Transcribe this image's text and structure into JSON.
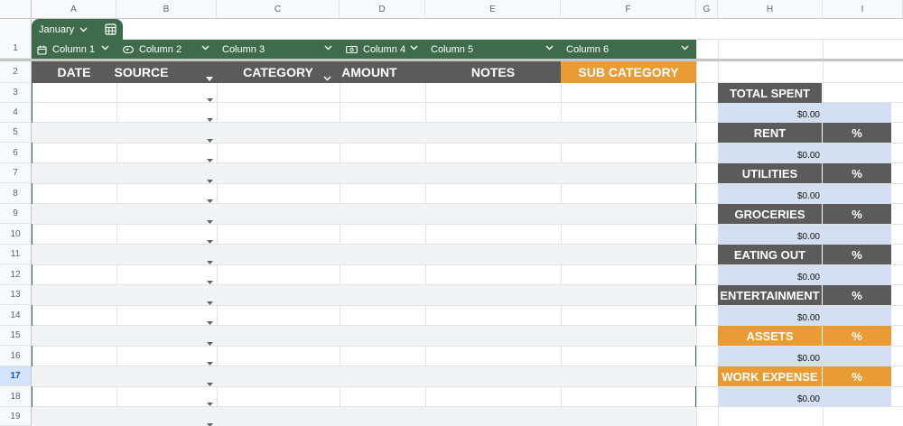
{
  "columns": [
    "A",
    "B",
    "C",
    "D",
    "E",
    "F",
    "G",
    "H",
    "I"
  ],
  "rows": [
    "1",
    "2",
    "3",
    "4",
    "5",
    "6",
    "7",
    "8",
    "9",
    "10",
    "11",
    "12",
    "13",
    "14",
    "15",
    "16",
    "17",
    "18",
    "19"
  ],
  "active_row": "17",
  "table": {
    "name": "January",
    "chips": [
      {
        "label": "Column 1",
        "icon": "calendar-icon"
      },
      {
        "label": "Column 2",
        "icon": "dropdown-chip-icon"
      },
      {
        "label": "Column 3",
        "icon": ""
      },
      {
        "label": "Column 4",
        "icon": "currency-icon"
      },
      {
        "label": "Column 5",
        "icon": ""
      },
      {
        "label": "Column 6",
        "icon": ""
      }
    ],
    "headers": [
      "DATE",
      "SOURCE",
      "CATEGORY",
      "AMOUNT",
      "NOTES",
      "SUB CATEGORY"
    ]
  },
  "summary": [
    {
      "title": "TOTAL SPENT",
      "pct": "",
      "value": "$0.00",
      "color": "#5b5b5b"
    },
    {
      "title": "RENT",
      "pct": "%",
      "value": "$0.00",
      "color": "#5b5b5b"
    },
    {
      "title": "UTILITIES",
      "pct": "%",
      "value": "$0.00",
      "color": "#5b5b5b"
    },
    {
      "title": "GROCERIES",
      "pct": "%",
      "value": "$0.00",
      "color": "#5b5b5b"
    },
    {
      "title": "EATING OUT",
      "pct": "%",
      "value": "$0.00",
      "color": "#5b5b5b"
    },
    {
      "title": "ENTERTAINMENT",
      "pct": "%",
      "value": "$0.00",
      "color": "#5b5b5b"
    },
    {
      "title": "ASSETS",
      "pct": "%",
      "value": "$0.00",
      "color": "#e99b35"
    },
    {
      "title": "WORK EXPENSE",
      "pct": "%",
      "value": "$0.00",
      "color": "#e99b35"
    }
  ],
  "colors": {
    "table_green": "#3f6b4d",
    "header_gray": "#5b5b5b",
    "accent_orange": "#e99b35",
    "value_blue": "#d4e0f2"
  }
}
